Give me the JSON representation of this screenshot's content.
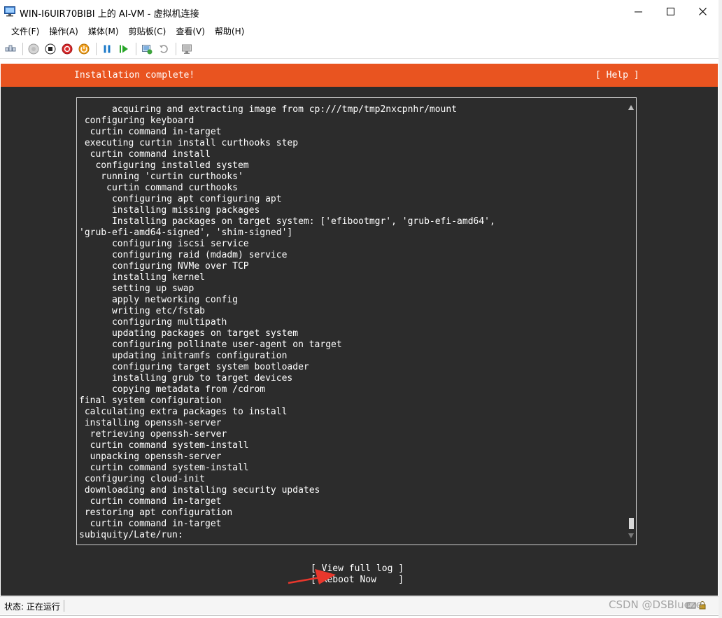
{
  "window": {
    "title": "WIN-I6UIR70BIBI 上的 AI-VM - 虚拟机连接"
  },
  "menu": {
    "items": [
      "文件(F)",
      "操作(A)",
      "媒体(M)",
      "剪贴板(C)",
      "查看(V)",
      "帮助(H)"
    ]
  },
  "toolbar": {
    "icons": [
      "ctrl-alt-del-icon",
      "start-icon",
      "stop-icon",
      "shutdown-icon",
      "power-icon",
      "pause-icon",
      "resume-icon",
      "checkpoint-icon",
      "revert-icon",
      "enhanced-session-icon"
    ]
  },
  "installer": {
    "header_title": "Installation complete!",
    "help_label": "[ Help ]",
    "log_lines": [
      "      acquiring and extracting image from cp:///tmp/tmp2nxcpnhr/mount",
      " configuring keyboard",
      "  curtin command in-target",
      " executing curtin install curthooks step",
      "  curtin command install",
      "   configuring installed system",
      "    running 'curtin curthooks'",
      "     curtin command curthooks",
      "      configuring apt configuring apt",
      "      installing missing packages",
      "      Installing packages on target system: ['efibootmgr', 'grub-efi-amd64',",
      "'grub-efi-amd64-signed', 'shim-signed']",
      "      configuring iscsi service",
      "      configuring raid (mdadm) service",
      "      configuring NVMe over TCP",
      "      installing kernel",
      "      setting up swap",
      "      apply networking config",
      "      writing etc/fstab",
      "      configuring multipath",
      "      updating packages on target system",
      "      configuring pollinate user-agent on target",
      "      updating initramfs configuration",
      "      configuring target system bootloader",
      "      installing grub to target devices",
      "      copying metadata from /cdrom",
      "final system configuration",
      " calculating extra packages to install",
      " installing openssh-server",
      "  retrieving openssh-server",
      "  curtin command system-install",
      "  unpacking openssh-server",
      "  curtin command system-install",
      " configuring cloud-init",
      " downloading and installing security updates",
      "  curtin command in-target",
      " restoring apt configuration",
      "  curtin command in-target",
      "subiquity/Late/run:"
    ],
    "view_log_label": "[ View full log ]",
    "reboot_label": "[ Reboot Now    ]"
  },
  "status": {
    "text": "状态: 正在运行"
  },
  "watermark": "CSDN @DSBlueze",
  "colors": {
    "ubuntu_orange": "#e95420",
    "terminal_bg": "#2c2c2c",
    "arrow_red": "#e8372c"
  }
}
